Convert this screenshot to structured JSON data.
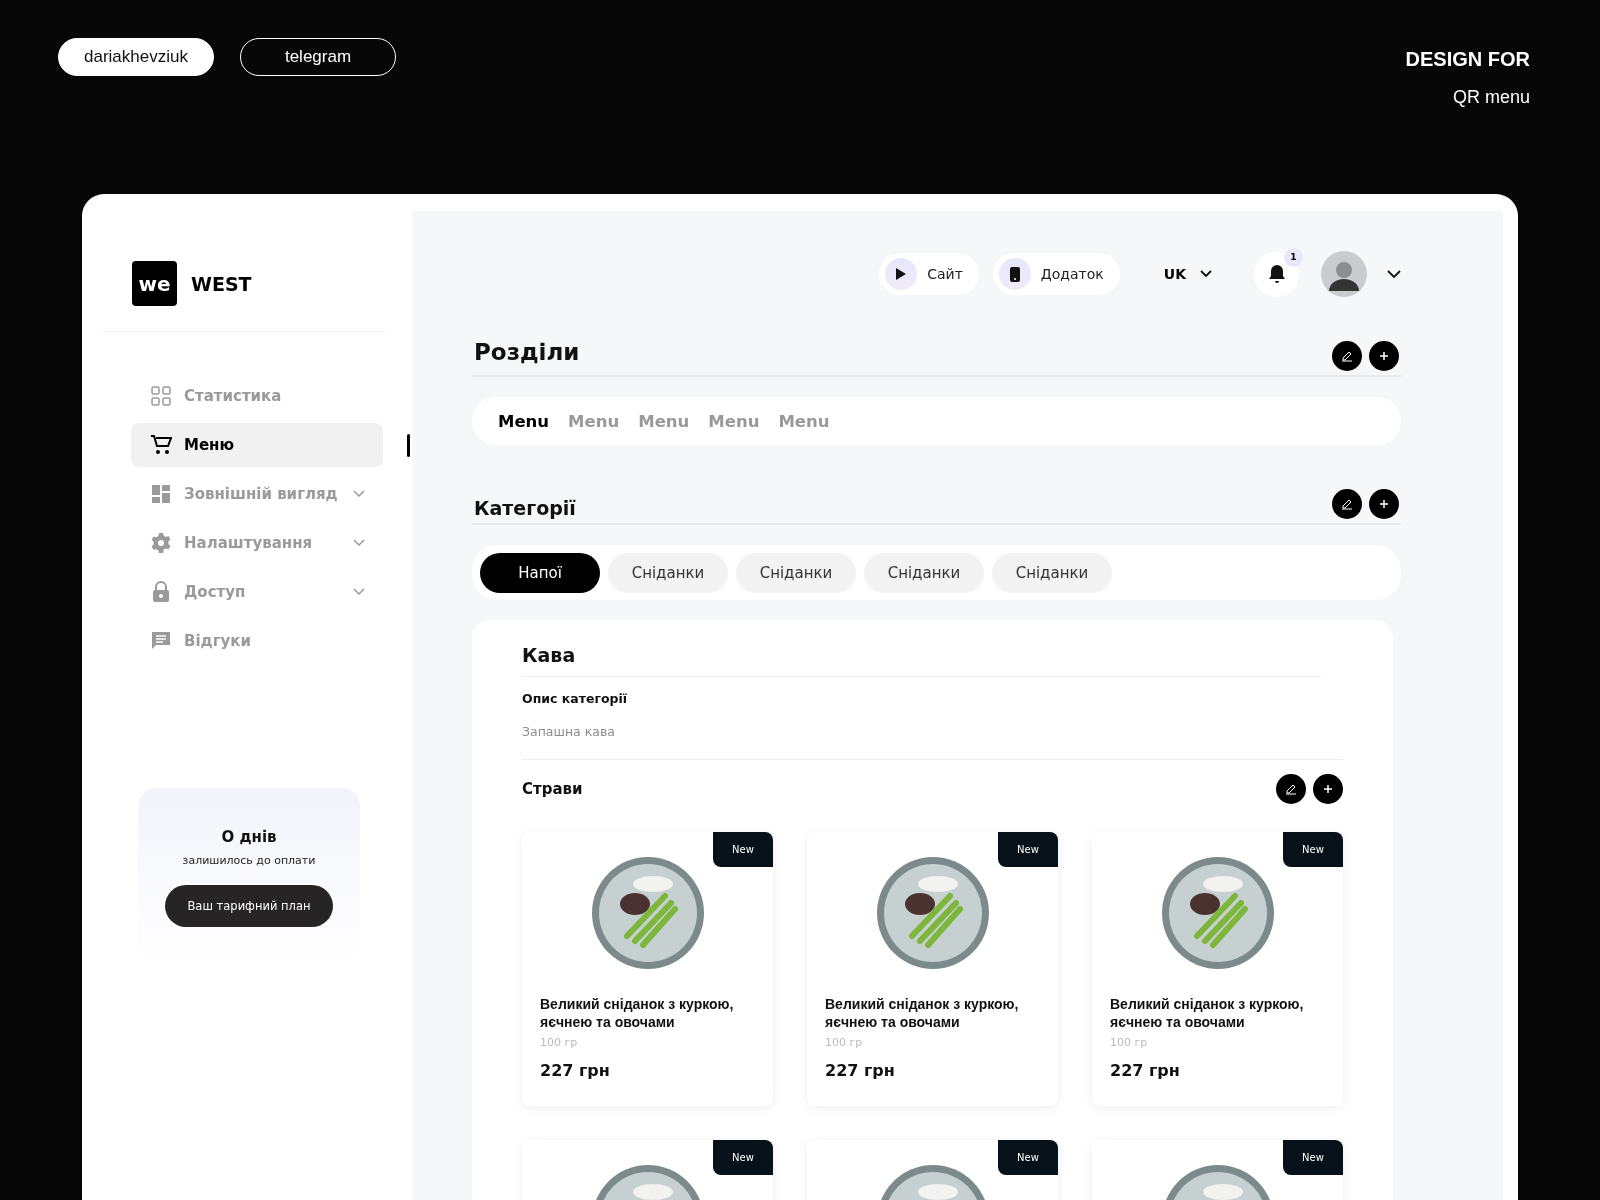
{
  "header": {
    "handle": "dariakhevziuk",
    "link": "telegram",
    "title": "DESIGN FOR",
    "subtitle": "QR menu"
  },
  "brand": {
    "logo": "we",
    "name": "WEST"
  },
  "sidebar": {
    "items": [
      {
        "label": "Статистика",
        "kind": "grid",
        "selected": false,
        "expandable": false
      },
      {
        "label": "Меню",
        "kind": "cart",
        "selected": true,
        "expandable": false
      },
      {
        "label": "Зовнішній вигляд",
        "kind": "layout",
        "selected": false,
        "expandable": true
      },
      {
        "label": "Налаштування",
        "kind": "gear",
        "selected": false,
        "expandable": true
      },
      {
        "label": "Доступ",
        "kind": "lock",
        "selected": false,
        "expandable": true
      },
      {
        "label": "Відгуки",
        "kind": "chat",
        "selected": false,
        "expandable": false
      }
    ]
  },
  "plan": {
    "days": "О днів",
    "caption": "залишилось до оплати",
    "button": "Ваш тарифний план"
  },
  "topbar": {
    "site": "Сайт",
    "app": "Додаток",
    "language": "UK",
    "notifications": "1"
  },
  "sections": {
    "title": "Розділи",
    "tabs": [
      {
        "label": "Menu",
        "selected": true
      },
      {
        "label": "Menu",
        "selected": false
      },
      {
        "label": "Menu",
        "selected": false
      },
      {
        "label": "Menu",
        "selected": false
      },
      {
        "label": "Menu",
        "selected": false
      }
    ]
  },
  "categories": {
    "title": "Категорії",
    "items": [
      {
        "label": "Напої",
        "selected": true
      },
      {
        "label": "Сніданки",
        "selected": false
      },
      {
        "label": "Сніданки",
        "selected": false
      },
      {
        "label": "Сніданки",
        "selected": false
      },
      {
        "label": "Сніданки",
        "selected": false
      }
    ]
  },
  "category": {
    "name": "Кава",
    "description_label": "Опис категорії",
    "description": "Запашна кава",
    "dishes_title": "Страви",
    "dishes": [
      {
        "badge": "New",
        "name": "Великий сніданок з куркою, яєчнею та овочами",
        "weight": "100 гр",
        "price": "227 грн"
      },
      {
        "badge": "New",
        "name": "Великий сніданок з куркою, яєчнею та овочами",
        "weight": "100 гр",
        "price": "227 грн"
      },
      {
        "badge": "New",
        "name": "Великий сніданок з куркою, яєчнею та овочами",
        "weight": "100 гр",
        "price": "227 грн"
      },
      {
        "badge": "New"
      },
      {
        "badge": "New"
      },
      {
        "badge": "New"
      }
    ]
  }
}
